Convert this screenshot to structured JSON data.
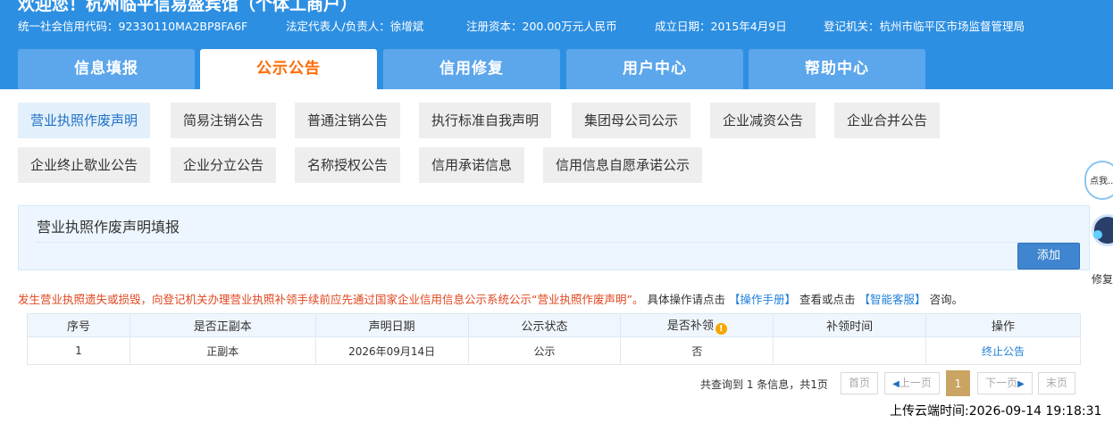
{
  "header": {
    "welcome": "欢迎您！杭州临平信易盛宾馆（个体工商户）",
    "info": {
      "credit_code": "统一社会信用代码：92330110MA2BP8FA6F",
      "legal_rep": "法定代表人/负责人：徐增斌",
      "capital": "注册资本：200.00万元人民币",
      "established": "成立日期：2015年4月9日",
      "authority": "登记机关：杭州市临平区市场监督管理局"
    },
    "tabs": [
      "信息填报",
      "公示公告",
      "信用修复",
      "用户中心",
      "帮助中心"
    ],
    "active_tab": "公示公告"
  },
  "categories": {
    "row1": [
      "营业执照作废声明",
      "简易注销公告",
      "普通注销公告",
      "执行标准自我声明",
      "集团母公司公示",
      "企业减资公告",
      "企业合并公告"
    ],
    "row2": [
      "企业终止歇业公告",
      "企业分立公告",
      "名称授权公告",
      "信用承诺信息",
      "信用信息自愿承诺公示"
    ],
    "active": "营业执照作废声明"
  },
  "panel": {
    "title": "营业执照作废声明填报",
    "add_label": "添加"
  },
  "notice": {
    "red": "发生营业执照遗失或损毁，向登记机关办理营业执照补领手续前应先通过国家企业信用信息公示系统公示“营业执照作废声明”。",
    "part1": "具体操作请点击",
    "link1": "【操作手册】",
    "part2": "查看或点击",
    "link2": "【智能客服】",
    "part3": "咨询。"
  },
  "table": {
    "headers": [
      "序号",
      "是否正副本",
      "声明日期",
      "公示状态",
      "是否补领",
      "补领时间",
      "操作"
    ],
    "rows": [
      {
        "no": "1",
        "copy": "正副本",
        "date": "2026年09月14日",
        "status": "公示",
        "reissue": "否",
        "reissue_time": "",
        "action": "终止公告"
      }
    ]
  },
  "pager": {
    "summary": "共查询到 1 条信息，共1页",
    "first": "首页",
    "prev": "上一页",
    "current": "1",
    "next": "下一页",
    "last": "末页"
  },
  "upload_time": "上传云端时间:2026-09-14 19:18:31",
  "assistant": {
    "bubble": "点我...",
    "label": "修复"
  },
  "colors": {
    "header_bg": "#2d8fe2",
    "tab_inactive": "#5ca6eb",
    "active_tab_text": "#ff6a00",
    "notice_red": "#e0461f",
    "link": "#1e7fd8",
    "pager_current": "#c9a463"
  }
}
